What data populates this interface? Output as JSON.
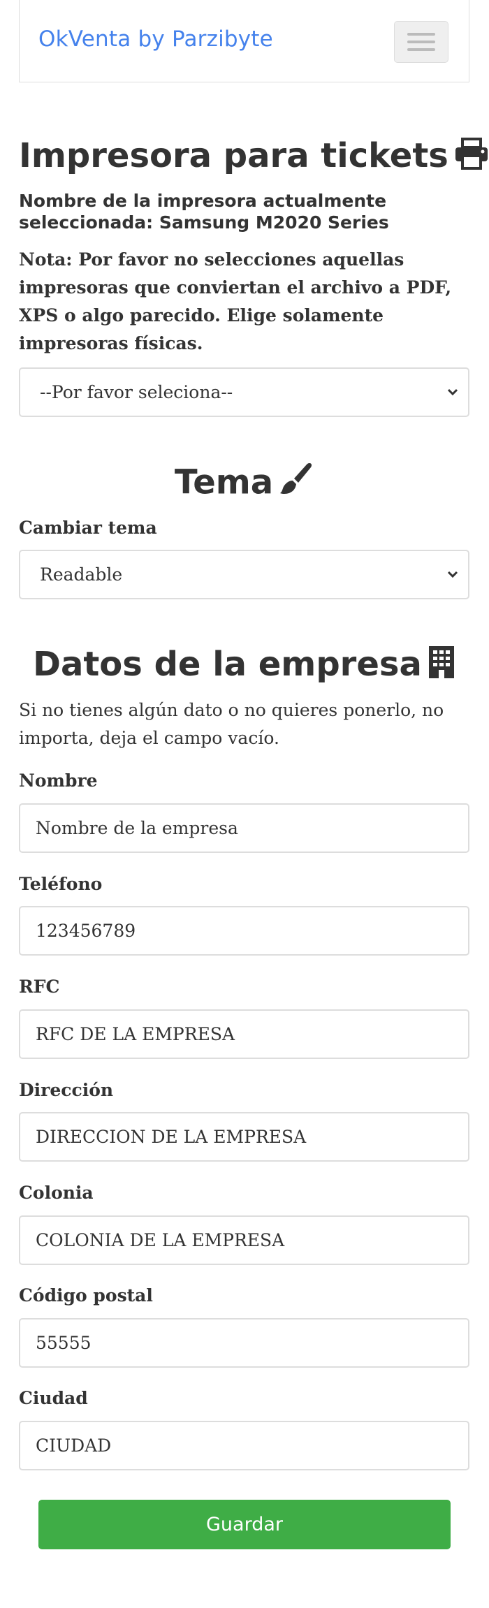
{
  "navbar": {
    "brand": "OkVenta by Parzibyte"
  },
  "printer": {
    "title": "Impresora para tickets",
    "current_line1": "Nombre de la impresora actualmente",
    "current_line2": "seleccionada: Samsung M2020 Series",
    "note": "Nota: Por favor no selecciones aquellas impresoras que conviertan el archivo a PDF, XPS o algo parecido. Elige solamente impresoras físicas.",
    "select_value": "--Por favor seleciona--"
  },
  "theme": {
    "title": "Tema",
    "label": "Cambiar tema",
    "select_value": "Readable"
  },
  "company": {
    "title": "Datos de la empresa",
    "description": "Si no tienes algún dato o no quieres ponerlo, no importa, deja el campo vacío.",
    "fields": {
      "name": {
        "label": "Nombre",
        "value": "Nombre de la empresa"
      },
      "phone": {
        "label": "Teléfono",
        "value": "123456789"
      },
      "rfc": {
        "label": "RFC",
        "value": "RFC DE LA EMPRESA"
      },
      "address": {
        "label": "Dirección",
        "value": "DIRECCION DE LA EMPRESA"
      },
      "colonia": {
        "label": "Colonia",
        "value": "COLONIA DE LA EMPRESA"
      },
      "postal": {
        "label": "Código postal",
        "value": "55555"
      },
      "city": {
        "label": "Ciudad",
        "value": "CIUDAD"
      }
    },
    "save_label": "Guardar"
  },
  "colors": {
    "brand": "#4582ec",
    "save_button": "#3fad46",
    "text": "#333333"
  },
  "icons": {
    "printer": "printer-icon",
    "theme": "paintbrush-icon",
    "company": "building-icon",
    "menu": "hamburger-menu-icon",
    "select": "chevron-down-icon"
  }
}
